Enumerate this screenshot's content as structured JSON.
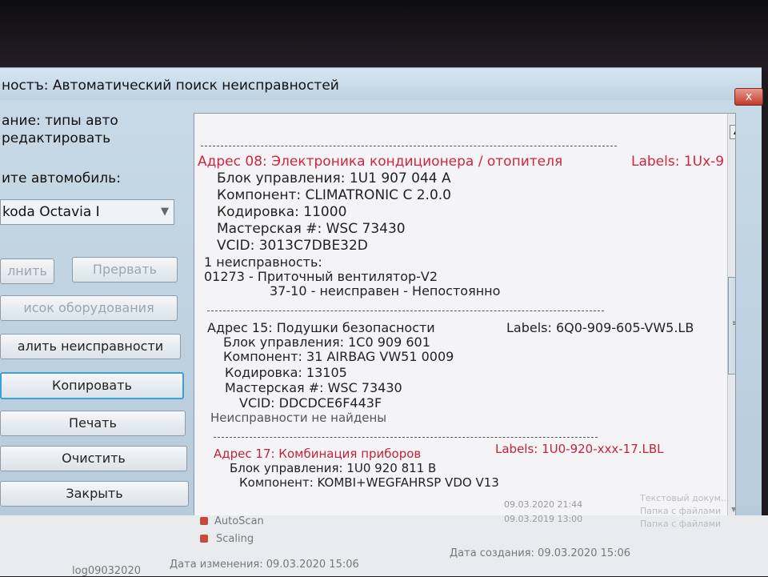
{
  "window": {
    "title": "ностъ: Автоматический поиск неисправностей",
    "close_label": "x"
  },
  "sidebar": {
    "line1": "ание: типы авто",
    "line2": "редактировать",
    "select_label": "ите автомобиль:",
    "selected_car": "koda Octavia I",
    "buttons": {
      "run": "лнить",
      "abort": "Прервать",
      "equipment": "исок оборудования",
      "clear_faults": "алить неисправности",
      "copy": "Копировать",
      "print": "Печать",
      "clear": "Очистить",
      "close": "Закрыть"
    }
  },
  "report": {
    "block08": {
      "address": "Адрес 08:  Электроника кондиционера / отопителя",
      "labels": "Labels: 1Ux-9",
      "unit": "Блок управления: 1U1 907 044 A",
      "component": "Компонент: CLIMATRONIC      C 2.0.0",
      "coding": "Кодировка: 11000",
      "workshop": "Мастерская #: WSC 73430",
      "vcid": "VCID: 3013C7DBE32D",
      "fault_count": "1 неисправность:",
      "fault_code": "01273 -    Приточный вентилятор-V2",
      "fault_detail": "37-10 -    неисправен - Непостоянно"
    },
    "block15": {
      "address": "Адрес 15:  Подушки безопасности",
      "labels": "Labels: 6Q0-909-605-VW5.LB",
      "unit": "Блок управления: 1C0 909 601",
      "component": "Компонент: 31 AIRBAG VW51        0009",
      "coding": "Кодировка: 13105",
      "workshop": "Мастерская #: WSC 73430",
      "vcid": "VCID: DDCDCE6F443F",
      "no_faults": "Неисправности не найдены"
    },
    "block17": {
      "address": "Адрес 17:  Комбинация приборов",
      "labels": "Labels: 1U0-920-xxx-17.LBL",
      "unit": "Блок управления: 1U0 920 811 B",
      "component": "Компонент: KOMBI+WEGFAHRSP VDO V13"
    }
  },
  "file_list": {
    "items": [
      {
        "name": "AutoScan"
      },
      {
        "name": "Scaling"
      }
    ],
    "footer_name": "log09032020",
    "modified": "Дата изменения: 09.03.2020 15:06",
    "created": "Дата создания: 09.03.2020 15:06",
    "right_col": [
      "09.03.2020 21:44",
      "09.03.2019 13:00",
      "Текстовый докум...",
      "Папка с файлами",
      "Папка с файлами"
    ]
  },
  "colors": {
    "address_red": "#d0253f",
    "window_bg": "#c9dbe8",
    "close_red": "#c0392b"
  }
}
